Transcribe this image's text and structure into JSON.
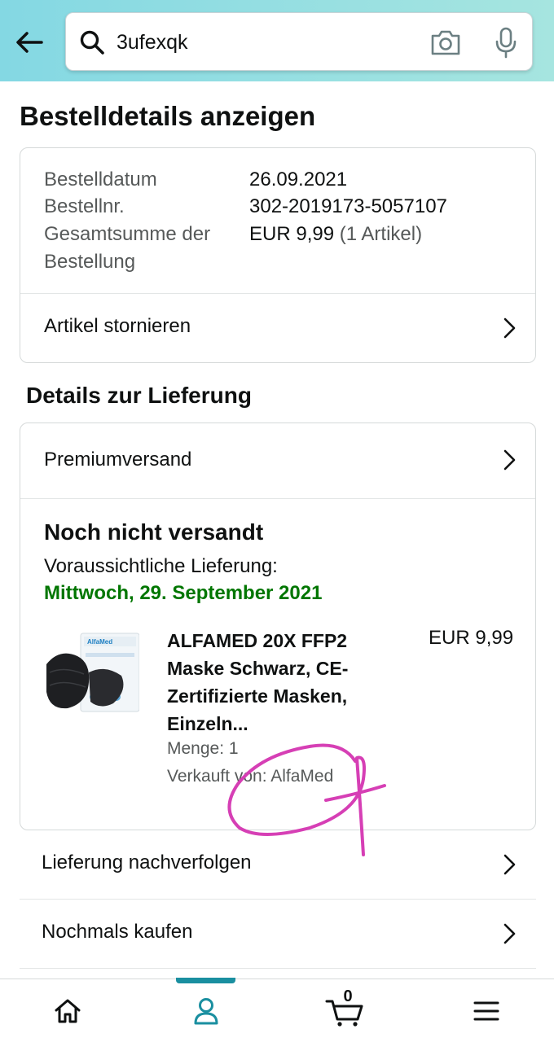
{
  "header": {
    "back_icon": "arrow-left-icon",
    "search": {
      "value": "3ufexqk",
      "placeholder": ""
    },
    "icons": [
      "search-icon",
      "camera-icon",
      "microphone-icon"
    ],
    "accent_gradient": [
      "#84d8e3",
      "#a6e5e0"
    ]
  },
  "page_title": "Bestelldetails anzeigen",
  "order_summary": {
    "rows": [
      {
        "label": "Bestelldatum",
        "value": "26.09.2021"
      },
      {
        "label": "Bestellnr.",
        "value": "302-2019173-5057107"
      },
      {
        "label": "Gesamtsumme der Bestellung",
        "value": "EUR 9,99",
        "value_note": "(1 Artikel)"
      }
    ],
    "cancel_link": "Artikel stornieren"
  },
  "delivery": {
    "section_title": "Details zur Lieferung",
    "shipping_method": "Premiumversand",
    "status": "Noch nicht versandt",
    "estimate_label": "Voraussichtliche Lieferung:",
    "estimate_date": "Mittwoch, 29. September 2021",
    "estimate_color": "#007600",
    "product": {
      "title": "ALFAMED 20X FFP2 Maske Schwarz, CE-Zertifizierte Masken, Einzeln...",
      "price": "EUR 9,99",
      "quantity": "Menge: 1",
      "seller": "Verkauft von: AlfaMed",
      "image_label": "AlfaMed"
    }
  },
  "actions": [
    {
      "label": "Lieferung nachverfolgen"
    },
    {
      "label": "Nochmals kaufen"
    }
  ],
  "bottom_nav": {
    "items": [
      "home-icon",
      "account-icon",
      "cart-icon",
      "menu-icon"
    ],
    "active": "account-icon",
    "cart_count": "0",
    "active_color": "#1a8fa0"
  },
  "annotation_color": "#d63fb5"
}
